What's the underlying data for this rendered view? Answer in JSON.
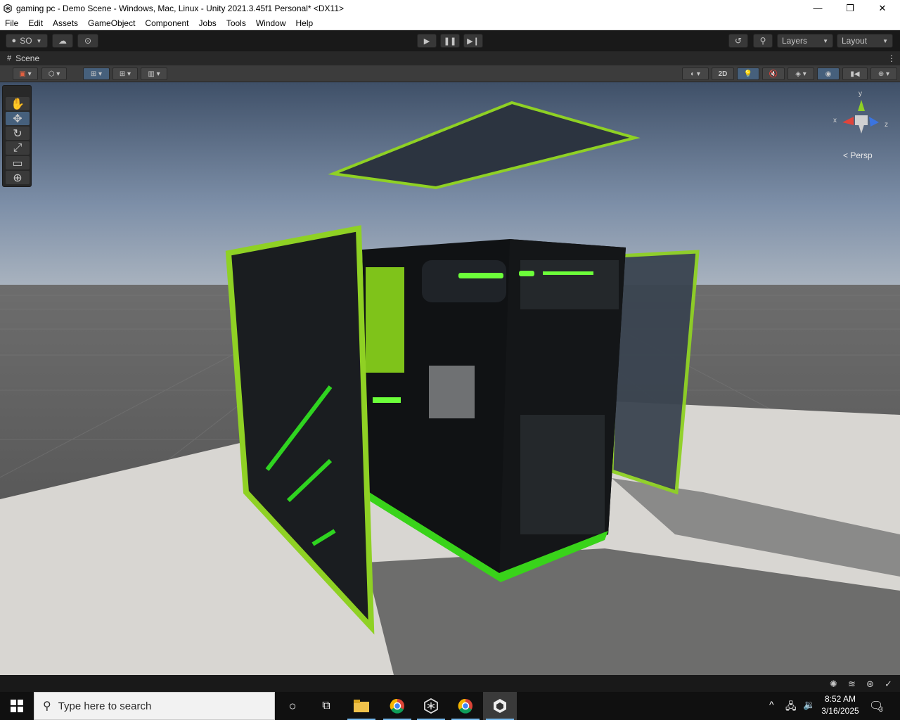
{
  "window": {
    "title": "gaming pc - Demo Scene - Windows, Mac, Linux - Unity 2021.3.45f1 Personal* <DX11>",
    "controls": {
      "minimize": "—",
      "maximize": "❐",
      "close": "✕"
    }
  },
  "menu": [
    "File",
    "Edit",
    "Assets",
    "GameObject",
    "Component",
    "Jobs",
    "Tools",
    "Window",
    "Help"
  ],
  "toolbar": {
    "account_label": "SO",
    "layers_label": "Layers",
    "layout_label": "Layout"
  },
  "scene_tab": {
    "label": "Scene"
  },
  "scene_toolbar": {
    "mode_2d": "2D"
  },
  "gizmo": {
    "y": "y",
    "x": "x",
    "z": "z",
    "projection": "< Persp"
  },
  "taskbar": {
    "search_placeholder": "Type here to search",
    "time": "8:52 AM",
    "date": "3/16/2025",
    "notification_count": "3"
  }
}
